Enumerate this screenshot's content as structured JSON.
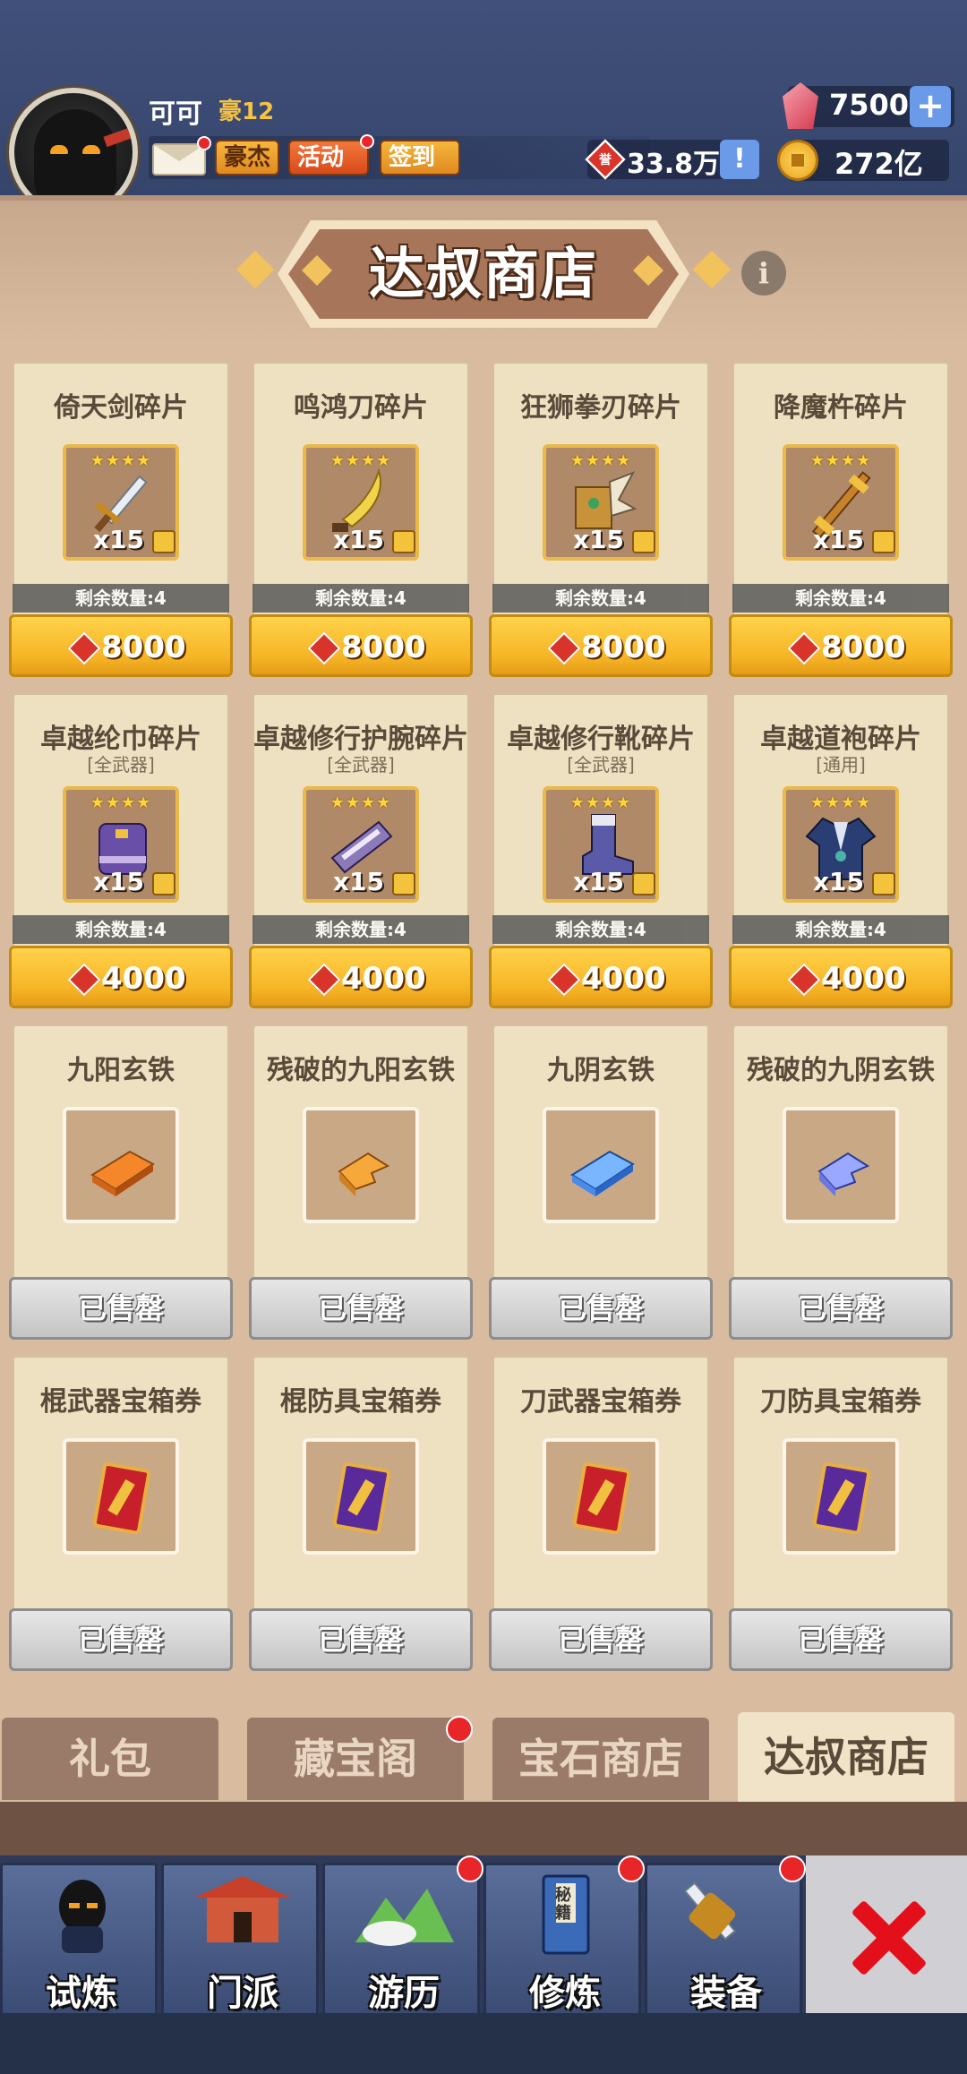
{
  "header": {
    "username": "可可",
    "rank": "豪12",
    "badges": {
      "hao": "豪杰",
      "huodong": "活动",
      "qiandao": "签到"
    },
    "honor_value": "33.8万",
    "honor_icon_text": "誉",
    "info_symbol": "!",
    "gems": "7500",
    "gems_plus": "+",
    "coins": "272亿"
  },
  "shop": {
    "title": "达叔商店",
    "info_symbol": "i",
    "items": [
      {
        "name": "倚天剑碎片",
        "sub": "",
        "qty": "x15",
        "remain": "剩余数量:4",
        "price": "8000",
        "sold": false,
        "icon": "sword-icon",
        "stars": "★★★★"
      },
      {
        "name": "鸣鸿刀碎片",
        "sub": "",
        "qty": "x15",
        "remain": "剩余数量:4",
        "price": "8000",
        "sold": false,
        "icon": "blade-icon",
        "stars": "★★★★"
      },
      {
        "name": "狂狮拳刃碎片",
        "sub": "",
        "qty": "x15",
        "remain": "剩余数量:4",
        "price": "8000",
        "sold": false,
        "icon": "fist-blade-icon",
        "stars": "★★★★"
      },
      {
        "name": "降魔杵碎片",
        "sub": "",
        "qty": "x15",
        "remain": "剩余数量:4",
        "price": "8000",
        "sold": false,
        "icon": "staff-icon",
        "stars": "★★★★"
      },
      {
        "name": "卓越纶巾碎片",
        "sub": "[全武器]",
        "qty": "x15",
        "remain": "剩余数量:4",
        "price": "4000",
        "sold": false,
        "icon": "headwear-icon",
        "stars": "★★★★"
      },
      {
        "name": "卓越修行护腕碎片",
        "sub": "[全武器]",
        "qty": "x15",
        "remain": "剩余数量:4",
        "price": "4000",
        "sold": false,
        "icon": "bracer-icon",
        "stars": "★★★★"
      },
      {
        "name": "卓越修行靴碎片",
        "sub": "[全武器]",
        "qty": "x15",
        "remain": "剩余数量:4",
        "price": "4000",
        "sold": false,
        "icon": "boots-icon",
        "stars": "★★★★"
      },
      {
        "name": "卓越道袍碎片",
        "sub": "[通用]",
        "qty": "x15",
        "remain": "剩余数量:4",
        "price": "4000",
        "sold": false,
        "icon": "robe-icon",
        "stars": "★★★★"
      },
      {
        "name": "九阳玄铁",
        "sub": "",
        "qty": "",
        "remain": "",
        "price": "",
        "sold": true,
        "sold_label": "已售罄",
        "icon": "orange-iron-icon",
        "stars": ""
      },
      {
        "name": "残破的九阳玄铁",
        "sub": "",
        "qty": "",
        "remain": "",
        "price": "",
        "sold": true,
        "sold_label": "已售罄",
        "icon": "broken-orange-iron-icon",
        "stars": ""
      },
      {
        "name": "九阴玄铁",
        "sub": "",
        "qty": "",
        "remain": "",
        "price": "",
        "sold": true,
        "sold_label": "已售罄",
        "icon": "blue-iron-icon",
        "stars": ""
      },
      {
        "name": "残破的九阴玄铁",
        "sub": "",
        "qty": "",
        "remain": "",
        "price": "",
        "sold": true,
        "sold_label": "已售罄",
        "icon": "broken-blue-iron-icon",
        "stars": ""
      },
      {
        "name": "棍武器宝箱券",
        "sub": "",
        "qty": "",
        "remain": "",
        "price": "",
        "sold": true,
        "sold_label": "已售罄",
        "icon": "red-ticket-icon",
        "stars": ""
      },
      {
        "name": "棍防具宝箱券",
        "sub": "",
        "qty": "",
        "remain": "",
        "price": "",
        "sold": true,
        "sold_label": "已售罄",
        "icon": "purple-ticket-icon",
        "stars": ""
      },
      {
        "name": "刀武器宝箱券",
        "sub": "",
        "qty": "",
        "remain": "",
        "price": "",
        "sold": true,
        "sold_label": "已售罄",
        "icon": "red-ticket-icon",
        "stars": ""
      },
      {
        "name": "刀防具宝箱券",
        "sub": "",
        "qty": "",
        "remain": "",
        "price": "",
        "sold": true,
        "sold_label": "已售罄",
        "icon": "purple-ticket-icon",
        "stars": ""
      }
    ]
  },
  "tabs": [
    {
      "label": "礼包",
      "active": false
    },
    {
      "label": "藏宝阁",
      "active": false,
      "dot": true
    },
    {
      "label": "宝石商店",
      "active": false
    },
    {
      "label": "达叔商店",
      "active": true
    }
  ],
  "nav": [
    {
      "label": "试炼",
      "icon": "ninja-icon",
      "dot": false
    },
    {
      "label": "门派",
      "icon": "temple-icon",
      "dot": false
    },
    {
      "label": "游历",
      "icon": "mountain-icon",
      "dot": true
    },
    {
      "label": "修炼",
      "icon": "book-icon",
      "dot": true,
      "book_text": "秘籍"
    },
    {
      "label": "装备",
      "icon": "equipment-icon",
      "dot": true
    }
  ],
  "colors": {
    "header_bg": "#3a4a72",
    "panel_bg": "#d9bca0",
    "price_gold": "#f6b525",
    "sold_gray": "#c4c4c4",
    "close_red": "#e3101c"
  }
}
